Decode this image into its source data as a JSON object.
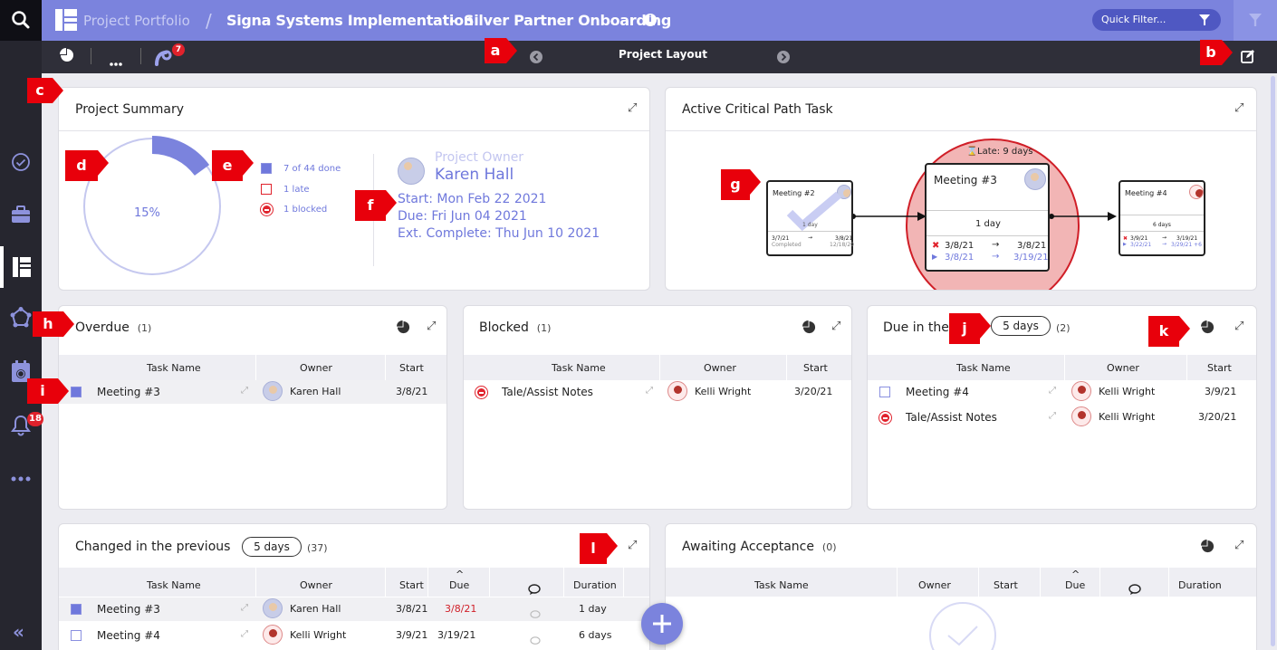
{
  "header": {
    "breadcrumb_root": "Project Portfolio",
    "separator": "/",
    "project": "Signa Systems Implementation",
    "dash": "-",
    "subtitle": "Silver Partner Onboarding",
    "quick_filter": "Quick Filter..."
  },
  "subbar": {
    "layout": "Project Layout",
    "notif_count": "7"
  },
  "sidebar": {
    "bell_count": "18"
  },
  "markers": {
    "a": "a",
    "b": "b",
    "c": "c",
    "d": "d",
    "e": "e",
    "f": "f",
    "g": "g",
    "h": "h",
    "i": "i",
    "j": "j",
    "k": "k",
    "l": "l"
  },
  "summary": {
    "title": "Project Summary",
    "percent": "15%",
    "progress": 0.15,
    "stat_done": "7 of 44 done",
    "stat_late": "1 late",
    "stat_blocked": "1 blocked",
    "owner_label": "Project Owner",
    "owner_name": "Karen Hall",
    "start": "Start: Mon Feb 22 2021",
    "due": "Due: Fri Jun 04 2021",
    "ext_complete": "Ext. Complete: Thu Jun 10 2021"
  },
  "critical": {
    "title": "Active Critical Path Task",
    "late": "Late: 9 days",
    "m2": {
      "name": "Meeting #2",
      "dur": "1 day",
      "d1": "3/7/21",
      "d2": "3/8/21",
      "status": "Completed",
      "d3": "12/18/20"
    },
    "m3": {
      "name": "Meeting #3",
      "dur": "1 day",
      "a1": "3/8/21",
      "a2": "3/8/21",
      "b1": "3/8/21",
      "b2": "3/19/21"
    },
    "m4": {
      "name": "Meeting #4",
      "dur": "6 days",
      "a1": "3/9/21",
      "a2": "3/19/21",
      "b1": "3/22/21",
      "b2": "3/29/21 +6"
    },
    "arrow": "→"
  },
  "overdue": {
    "title": "Overdue",
    "count": "(1)",
    "h_task": "Task Name",
    "h_owner": "Owner",
    "h_start": "Start",
    "rows": [
      {
        "task": "Meeting #3",
        "owner": "Karen Hall",
        "start": "3/8/21"
      }
    ]
  },
  "blocked": {
    "title": "Blocked",
    "count": "(1)",
    "h_task": "Task Name",
    "h_owner": "Owner",
    "h_start": "Start",
    "rows": [
      {
        "task": "Tale/Assist Notes",
        "owner": "Kelli Wright",
        "start": "3/20/21"
      }
    ]
  },
  "duein": {
    "title": "Due in the",
    "days": "5 days",
    "count": "(2)",
    "h_task": "Task Name",
    "h_owner": "Owner",
    "h_start": "Start",
    "rows": [
      {
        "task": "Meeting #4",
        "owner": "Kelli Wright",
        "start": "3/9/21"
      },
      {
        "task": "Tale/Assist Notes",
        "owner": "Kelli Wright",
        "start": "3/20/21"
      }
    ]
  },
  "changed": {
    "title": "Changed in the previous",
    "days": "5 days",
    "count": "(37)",
    "h_task": "Task Name",
    "h_owner": "Owner",
    "h_start": "Start",
    "h_due": "Due",
    "h_duration": "Duration",
    "sort": "^",
    "rows": [
      {
        "task": "Meeting #3",
        "owner": "Karen Hall",
        "start": "3/8/21",
        "due": "3/8/21",
        "duration": "1 day"
      },
      {
        "task": "Meeting #4",
        "owner": "Kelli Wright",
        "start": "3/9/21",
        "due": "3/19/21",
        "duration": "6 days"
      }
    ]
  },
  "awaiting": {
    "title": "Awaiting Acceptance",
    "count": "(0)",
    "h_task": "Task Name",
    "h_owner": "Owner",
    "h_start": "Start",
    "h_due": "Due",
    "h_duration": "Duration",
    "sort": "^"
  },
  "colors": {
    "accent": "#7b83dd",
    "late": "#e0222c",
    "dark": "#26262f"
  }
}
